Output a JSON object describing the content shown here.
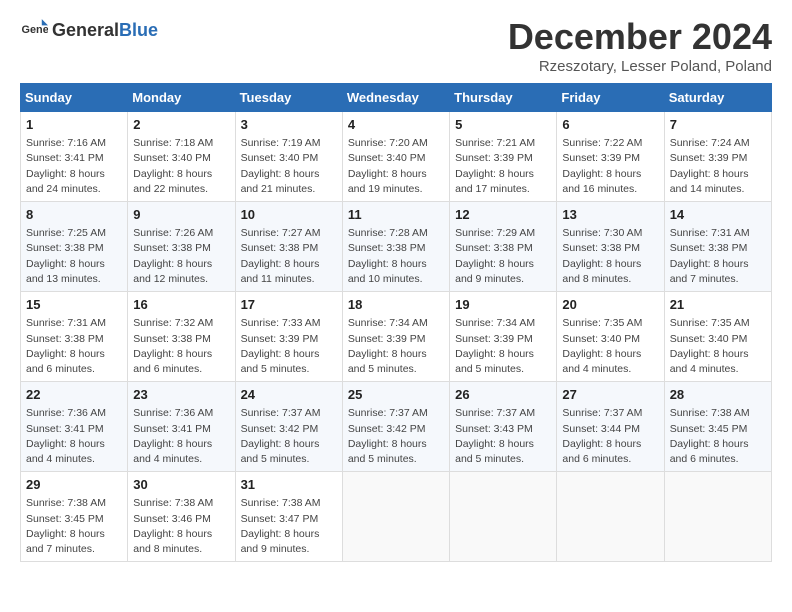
{
  "logo": {
    "general": "General",
    "blue": "Blue"
  },
  "title": "December 2024",
  "location": "Rzeszotary, Lesser Poland, Poland",
  "headers": [
    "Sunday",
    "Monday",
    "Tuesday",
    "Wednesday",
    "Thursday",
    "Friday",
    "Saturday"
  ],
  "weeks": [
    [
      {
        "day": "1",
        "sunrise": "Sunrise: 7:16 AM",
        "sunset": "Sunset: 3:41 PM",
        "daylight": "Daylight: 8 hours and 24 minutes."
      },
      {
        "day": "2",
        "sunrise": "Sunrise: 7:18 AM",
        "sunset": "Sunset: 3:40 PM",
        "daylight": "Daylight: 8 hours and 22 minutes."
      },
      {
        "day": "3",
        "sunrise": "Sunrise: 7:19 AM",
        "sunset": "Sunset: 3:40 PM",
        "daylight": "Daylight: 8 hours and 21 minutes."
      },
      {
        "day": "4",
        "sunrise": "Sunrise: 7:20 AM",
        "sunset": "Sunset: 3:40 PM",
        "daylight": "Daylight: 8 hours and 19 minutes."
      },
      {
        "day": "5",
        "sunrise": "Sunrise: 7:21 AM",
        "sunset": "Sunset: 3:39 PM",
        "daylight": "Daylight: 8 hours and 17 minutes."
      },
      {
        "day": "6",
        "sunrise": "Sunrise: 7:22 AM",
        "sunset": "Sunset: 3:39 PM",
        "daylight": "Daylight: 8 hours and 16 minutes."
      },
      {
        "day": "7",
        "sunrise": "Sunrise: 7:24 AM",
        "sunset": "Sunset: 3:39 PM",
        "daylight": "Daylight: 8 hours and 14 minutes."
      }
    ],
    [
      {
        "day": "8",
        "sunrise": "Sunrise: 7:25 AM",
        "sunset": "Sunset: 3:38 PM",
        "daylight": "Daylight: 8 hours and 13 minutes."
      },
      {
        "day": "9",
        "sunrise": "Sunrise: 7:26 AM",
        "sunset": "Sunset: 3:38 PM",
        "daylight": "Daylight: 8 hours and 12 minutes."
      },
      {
        "day": "10",
        "sunrise": "Sunrise: 7:27 AM",
        "sunset": "Sunset: 3:38 PM",
        "daylight": "Daylight: 8 hours and 11 minutes."
      },
      {
        "day": "11",
        "sunrise": "Sunrise: 7:28 AM",
        "sunset": "Sunset: 3:38 PM",
        "daylight": "Daylight: 8 hours and 10 minutes."
      },
      {
        "day": "12",
        "sunrise": "Sunrise: 7:29 AM",
        "sunset": "Sunset: 3:38 PM",
        "daylight": "Daylight: 8 hours and 9 minutes."
      },
      {
        "day": "13",
        "sunrise": "Sunrise: 7:30 AM",
        "sunset": "Sunset: 3:38 PM",
        "daylight": "Daylight: 8 hours and 8 minutes."
      },
      {
        "day": "14",
        "sunrise": "Sunrise: 7:31 AM",
        "sunset": "Sunset: 3:38 PM",
        "daylight": "Daylight: 8 hours and 7 minutes."
      }
    ],
    [
      {
        "day": "15",
        "sunrise": "Sunrise: 7:31 AM",
        "sunset": "Sunset: 3:38 PM",
        "daylight": "Daylight: 8 hours and 6 minutes."
      },
      {
        "day": "16",
        "sunrise": "Sunrise: 7:32 AM",
        "sunset": "Sunset: 3:38 PM",
        "daylight": "Daylight: 8 hours and 6 minutes."
      },
      {
        "day": "17",
        "sunrise": "Sunrise: 7:33 AM",
        "sunset": "Sunset: 3:39 PM",
        "daylight": "Daylight: 8 hours and 5 minutes."
      },
      {
        "day": "18",
        "sunrise": "Sunrise: 7:34 AM",
        "sunset": "Sunset: 3:39 PM",
        "daylight": "Daylight: 8 hours and 5 minutes."
      },
      {
        "day": "19",
        "sunrise": "Sunrise: 7:34 AM",
        "sunset": "Sunset: 3:39 PM",
        "daylight": "Daylight: 8 hours and 5 minutes."
      },
      {
        "day": "20",
        "sunrise": "Sunrise: 7:35 AM",
        "sunset": "Sunset: 3:40 PM",
        "daylight": "Daylight: 8 hours and 4 minutes."
      },
      {
        "day": "21",
        "sunrise": "Sunrise: 7:35 AM",
        "sunset": "Sunset: 3:40 PM",
        "daylight": "Daylight: 8 hours and 4 minutes."
      }
    ],
    [
      {
        "day": "22",
        "sunrise": "Sunrise: 7:36 AM",
        "sunset": "Sunset: 3:41 PM",
        "daylight": "Daylight: 8 hours and 4 minutes."
      },
      {
        "day": "23",
        "sunrise": "Sunrise: 7:36 AM",
        "sunset": "Sunset: 3:41 PM",
        "daylight": "Daylight: 8 hours and 4 minutes."
      },
      {
        "day": "24",
        "sunrise": "Sunrise: 7:37 AM",
        "sunset": "Sunset: 3:42 PM",
        "daylight": "Daylight: 8 hours and 5 minutes."
      },
      {
        "day": "25",
        "sunrise": "Sunrise: 7:37 AM",
        "sunset": "Sunset: 3:42 PM",
        "daylight": "Daylight: 8 hours and 5 minutes."
      },
      {
        "day": "26",
        "sunrise": "Sunrise: 7:37 AM",
        "sunset": "Sunset: 3:43 PM",
        "daylight": "Daylight: 8 hours and 5 minutes."
      },
      {
        "day": "27",
        "sunrise": "Sunrise: 7:37 AM",
        "sunset": "Sunset: 3:44 PM",
        "daylight": "Daylight: 8 hours and 6 minutes."
      },
      {
        "day": "28",
        "sunrise": "Sunrise: 7:38 AM",
        "sunset": "Sunset: 3:45 PM",
        "daylight": "Daylight: 8 hours and 6 minutes."
      }
    ],
    [
      {
        "day": "29",
        "sunrise": "Sunrise: 7:38 AM",
        "sunset": "Sunset: 3:45 PM",
        "daylight": "Daylight: 8 hours and 7 minutes."
      },
      {
        "day": "30",
        "sunrise": "Sunrise: 7:38 AM",
        "sunset": "Sunset: 3:46 PM",
        "daylight": "Daylight: 8 hours and 8 minutes."
      },
      {
        "day": "31",
        "sunrise": "Sunrise: 7:38 AM",
        "sunset": "Sunset: 3:47 PM",
        "daylight": "Daylight: 8 hours and 9 minutes."
      },
      null,
      null,
      null,
      null
    ]
  ]
}
